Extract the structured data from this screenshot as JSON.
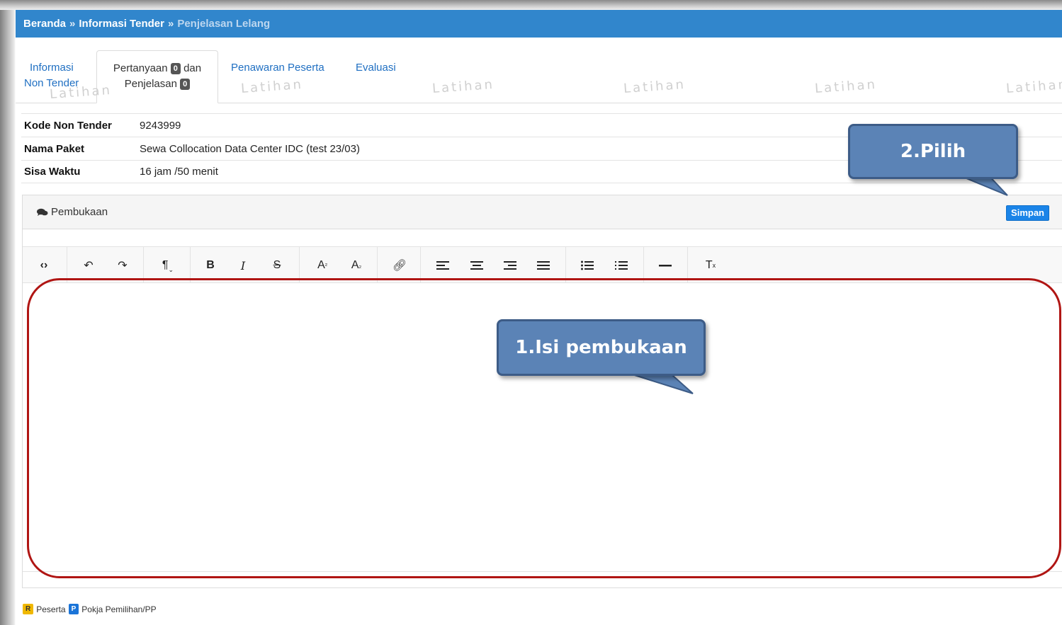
{
  "breadcrumb": {
    "home": "Beranda",
    "separator": "»",
    "tender": "Informasi Tender",
    "current": "Penjelasan Lelang"
  },
  "tabs": [
    {
      "line1": "Informasi",
      "line2": "Non Tender"
    },
    {
      "line1_a": "Pertanyaan",
      "badge1": "0",
      "line1_b": "dan",
      "line2": "Penjelasan",
      "badge2": "0"
    },
    {
      "label": "Penawaran Peserta"
    },
    {
      "label": "Evaluasi"
    }
  ],
  "watermark": "Latihan",
  "info": {
    "kode_label": "Kode Non Tender",
    "kode_value": "9243999",
    "nama_label": "Nama Paket",
    "nama_value": "Sewa Collocation Data Center IDC (test 23/03)",
    "sisa_label": "Sisa Waktu",
    "sisa_value": "16 jam /50 menit"
  },
  "panel": {
    "title": "Pembukaan",
    "save_label": "Simpan"
  },
  "callouts": {
    "step1": "1.Isi pembukaan",
    "step2": "2.Pilih"
  },
  "legend": {
    "r_badge": "R",
    "r_label": "Peserta",
    "p_badge": "P",
    "p_label": "Pokja Pemilihan/PP"
  },
  "colors": {
    "header_blue": "#3186cc",
    "callout_fill": "#5b83b6",
    "annotation_red": "#b01513",
    "save_button": "#1a84e8"
  }
}
